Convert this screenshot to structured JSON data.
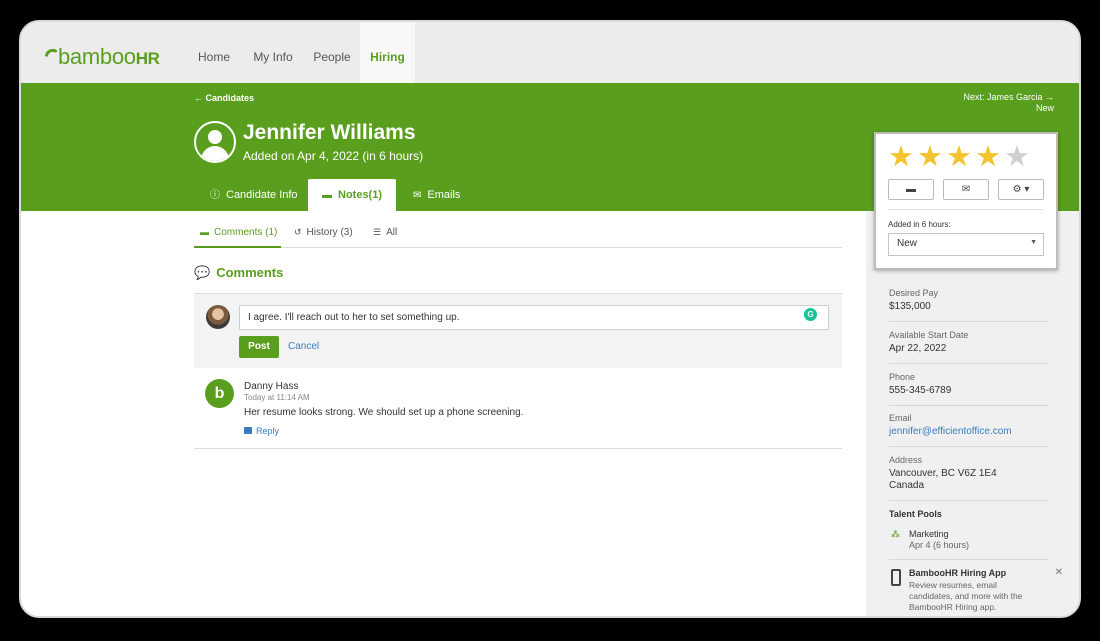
{
  "app": {
    "logo_main": "bamboo",
    "logo_suffix": "HR"
  },
  "nav": {
    "items": [
      "Home",
      "My Info",
      "People",
      "Hiring"
    ],
    "active": "Hiring"
  },
  "header": {
    "back_label": "← Candidates",
    "next_label": "Next: James Garcia →",
    "next_sub": "New",
    "name": "Jennifer Williams",
    "added": "Added on Apr 4, 2022 (in 6 hours)"
  },
  "tabs": {
    "candidate_info": "Candidate Info",
    "notes": "Notes(1)",
    "emails": "Emails"
  },
  "subtabs": {
    "comments": "Comments (1)",
    "history": "History (3)",
    "all": "All"
  },
  "comments_section": {
    "title": "Comments",
    "input_value": "I agree. I'll reach out to her to set something up.",
    "post_label": "Post",
    "cancel_label": "Cancel"
  },
  "comment": {
    "author": "Danny Hass",
    "time": "Today at 11:14 AM",
    "text": "Her resume looks strong. We should set up a phone screening.",
    "reply_label": "Reply"
  },
  "rating": {
    "value": 4,
    "max": 5
  },
  "status": {
    "label": "Added in 6 hours:",
    "value": "New"
  },
  "info": {
    "desired_pay_label": "Desired Pay",
    "desired_pay": "$135,000",
    "start_label": "Available Start Date",
    "start": "Apr 22, 2022",
    "phone_label": "Phone",
    "phone": "555-345-6789",
    "email_label": "Email",
    "email": "jennifer@efficientoffice.com",
    "address_label": "Address",
    "address_line1": "Vancouver, BC V6Z 1E4",
    "address_line2": "Canada"
  },
  "talent_pools": {
    "title": "Talent Pools",
    "pool_name": "Marketing",
    "pool_date": "Apr 4 (6 hours)"
  },
  "app_promo": {
    "title": "BambooHR Hiring App",
    "desc": "Review resumes, email candidates, and more with the BambooHR Hiring app."
  },
  "colors": {
    "brand_green": "#5a9e1e",
    "link_blue": "#3a7bbf",
    "star": "#f4c430"
  }
}
